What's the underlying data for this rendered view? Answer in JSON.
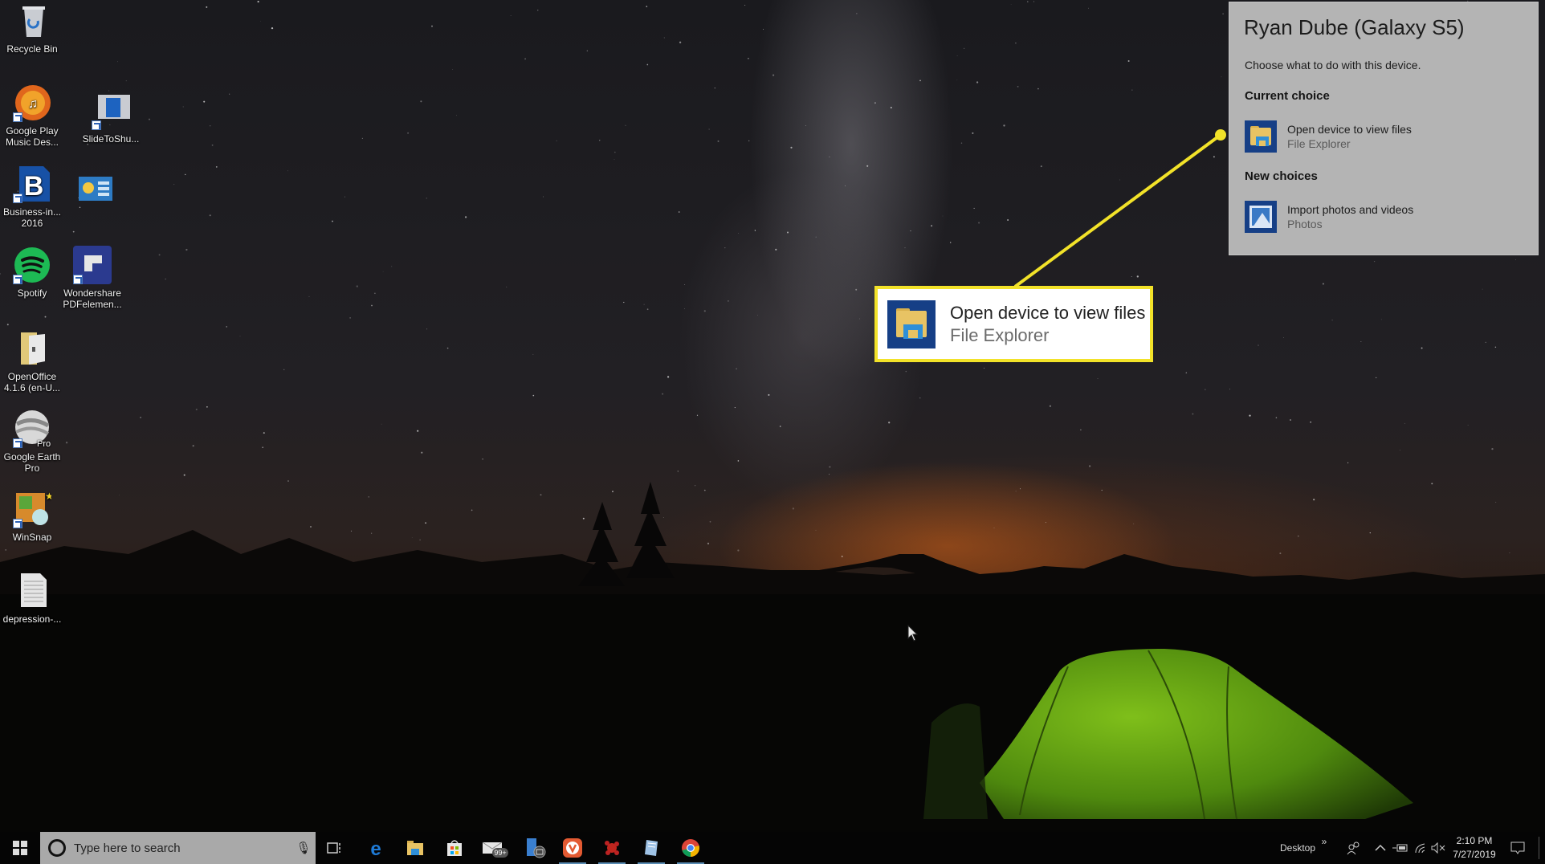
{
  "desktop": {
    "icons": [
      {
        "label": "Recycle Bin",
        "icon": "recycle-bin-icon"
      },
      {
        "label": "Google Play Music Des...",
        "icon": "google-play-music-icon"
      },
      {
        "label": "SlideToShu...",
        "icon": "slide-to-shutdown-icon"
      },
      {
        "label": "Business-in... 2016",
        "icon": "business-document-icon"
      },
      {
        "label": "",
        "icon": "dashboard-app-icon"
      },
      {
        "label": "Spotify",
        "icon": "spotify-icon"
      },
      {
        "label": "Wondershare PDFelemen...",
        "icon": "pdfelement-icon"
      },
      {
        "label": "OpenOffice 4.1.6 (en-U...",
        "icon": "openoffice-folder-icon"
      },
      {
        "label": "Google Earth Pro",
        "icon": "google-earth-pro-icon",
        "badge": "Pro"
      },
      {
        "label": "WinSnap",
        "icon": "winsnap-icon"
      },
      {
        "label": "depression-...",
        "icon": "text-document-icon"
      }
    ]
  },
  "autoplay": {
    "title": "Ryan Dube (Galaxy S5)",
    "subtitle": "Choose what to do with this device.",
    "current_heading": "Current choice",
    "current": {
      "action": "Open device to view files",
      "app": "File Explorer",
      "icon": "file-explorer-icon"
    },
    "new_heading": "New choices",
    "new": [
      {
        "action": "Import photos and videos",
        "app": "Photos",
        "icon": "photos-icon"
      }
    ]
  },
  "callout": {
    "action": "Open device to view files",
    "app": "File Explorer",
    "accent": "#f2e229"
  },
  "taskbar": {
    "search_placeholder": "Type here to search",
    "apps": [
      {
        "name": "task-view",
        "running": false
      },
      {
        "name": "edge",
        "running": false
      },
      {
        "name": "file-explorer",
        "running": false
      },
      {
        "name": "microsoft-store",
        "running": false
      },
      {
        "name": "mail",
        "running": false,
        "badge": "99+"
      },
      {
        "name": "your-phone",
        "running": false
      },
      {
        "name": "vivaldi",
        "running": true
      },
      {
        "name": "red-app",
        "running": true
      },
      {
        "name": "notepad-app",
        "running": true
      },
      {
        "name": "chrome",
        "running": true
      }
    ],
    "desktop_toolbar_label": "Desktop",
    "overflow_label": "»",
    "time": "2:10 PM",
    "date": "7/27/2019",
    "accent": "#76b9ed"
  }
}
